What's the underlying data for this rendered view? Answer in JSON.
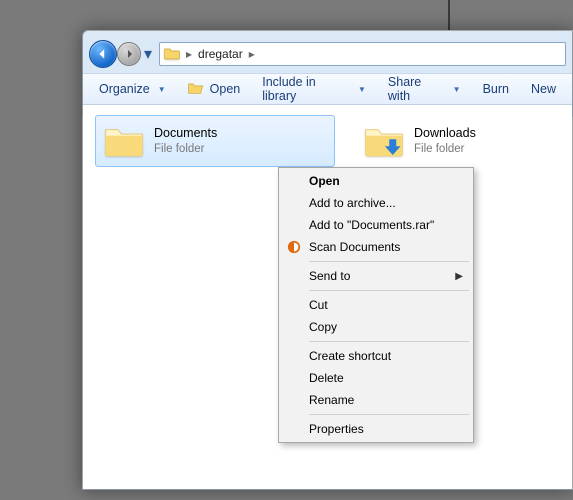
{
  "nav": {
    "crumb_sep": "▸",
    "crumb": "dregatar",
    "crumb_sep2": "▸"
  },
  "toolbar": {
    "organize": "Organize",
    "open": "Open",
    "include": "Include in library",
    "share": "Share with",
    "burn": "Burn",
    "new": "New"
  },
  "tiles": {
    "documents": {
      "name": "Documents",
      "sub": "File folder"
    },
    "downloads": {
      "name": "Downloads",
      "sub": "File folder"
    }
  },
  "context": {
    "open": "Open",
    "add_archive": "Add to archive...",
    "add_rar": "Add to \"Documents.rar\"",
    "scan": "Scan Documents",
    "sendto": "Send to",
    "cut": "Cut",
    "copy": "Copy",
    "shortcut": "Create shortcut",
    "delete": "Delete",
    "rename": "Rename",
    "properties": "Properties"
  }
}
